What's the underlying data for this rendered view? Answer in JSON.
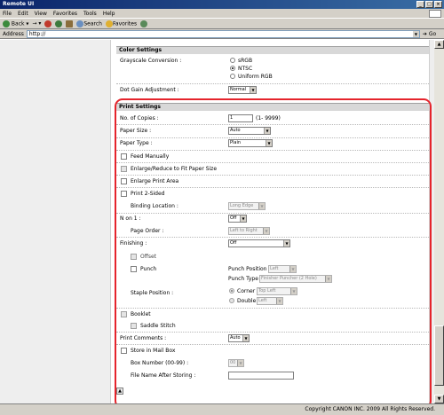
{
  "window": {
    "title": "Remote UI"
  },
  "menu": [
    "File",
    "Edit",
    "View",
    "Favorites",
    "Tools",
    "Help"
  ],
  "toolbar": {
    "back": "Back",
    "search": "Search",
    "favorites": "Favorites"
  },
  "address": {
    "label": "Address",
    "value": "http://",
    "go": "Go"
  },
  "color_settings": {
    "header": "Color Settings",
    "grayscale_label": "Grayscale Conversion :",
    "grayscale_options": [
      "sRGB",
      "NTSC",
      "Uniform RGB"
    ],
    "grayscale_selected": "NTSC",
    "dot_gain_label": "Dot Gain Adjustment :",
    "dot_gain_value": "Normal"
  },
  "print_settings": {
    "header": "Print Settings",
    "copies_label": "No. of Copies :",
    "copies_value": "1",
    "copies_range": "(1- 9999)",
    "paper_size_label": "Paper Size :",
    "paper_size_value": "Auto",
    "paper_type_label": "Paper Type :",
    "paper_type_value": "Plain",
    "feed_manually": "Feed Manually",
    "enlarge_reduce": "Enlarge/Reduce to Fit Paper Size",
    "enlarge_area": "Enlarge Print Area",
    "print_2sided": "Print 2-Sided",
    "binding_label": "Binding Location :",
    "binding_value": "Long Edge",
    "n_on_1_label": "N on 1 :",
    "n_on_1_value": "Off",
    "page_order_label": "Page Order :",
    "page_order_value": "Left to Right",
    "finishing_label": "Finishing :",
    "finishing_value": "Off",
    "offset": "Offset",
    "punch": "Punch",
    "punch_position_label": "Punch Position",
    "punch_position_value": "Left",
    "punch_type_label": "Punch Type",
    "punch_type_value": "Finisher Puncher (2 Hole)",
    "staple_label": "Staple Position :",
    "staple_corner": "Corner",
    "staple_corner_value": "Top Left",
    "staple_double": "Double",
    "staple_double_value": "Left",
    "booklet": "Booklet",
    "saddle_stitch": "Saddle Stitch",
    "comments_label": "Print Comments :",
    "comments_value": "Auto",
    "store_mailbox": "Store in Mail Box",
    "box_number_label": "Box Number (00-99) :",
    "box_number_value": "00",
    "file_name_label": "File Name After Storing :",
    "file_name_value": ""
  },
  "status": {
    "copyright": "Copyright CANON INC. 2009 All Rights Reserved."
  }
}
